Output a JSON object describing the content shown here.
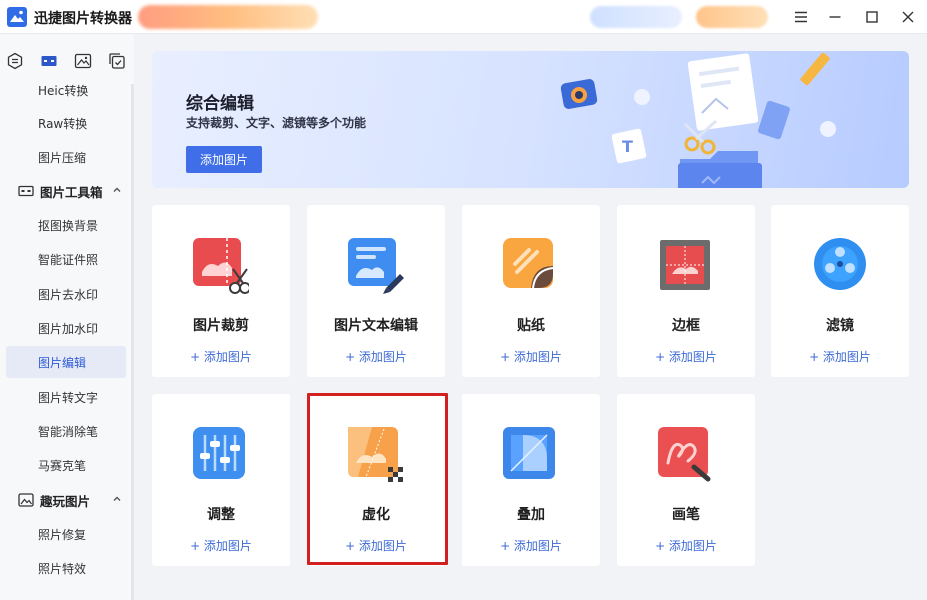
{
  "app": {
    "title": "迅捷图片转换器"
  },
  "sidebar": {
    "items": [
      {
        "label": "Heic转换",
        "active": false
      },
      {
        "label": "Raw转换",
        "active": false
      },
      {
        "label": "图片压缩",
        "active": false
      }
    ],
    "group_toolbox": "图片工具箱",
    "toolbox_items": [
      {
        "label": "抠图换背景"
      },
      {
        "label": "智能证件照"
      },
      {
        "label": "图片去水印"
      },
      {
        "label": "图片加水印"
      },
      {
        "label": "图片编辑"
      },
      {
        "label": "图片转文字"
      },
      {
        "label": "智能消除笔"
      },
      {
        "label": "马赛克笔"
      }
    ],
    "group_fun": "趣玩图片",
    "fun_items": [
      {
        "label": "照片修复"
      },
      {
        "label": "照片特效"
      }
    ]
  },
  "hero": {
    "title": "综合编辑",
    "subtitle": "支持裁剪、文字、滤镜等多个功能",
    "button": "添加图片"
  },
  "cards": [
    {
      "label": "图片裁剪",
      "add": "+ 添加图片",
      "icon": "crop-icon"
    },
    {
      "label": "图片文本编辑",
      "add": "+ 添加图片",
      "icon": "text-edit-icon"
    },
    {
      "label": "贴纸",
      "add": "+ 添加图片",
      "icon": "sticker-icon"
    },
    {
      "label": "边框",
      "add": "+ 添加图片",
      "icon": "border-icon"
    },
    {
      "label": "滤镜",
      "add": "+ 添加图片",
      "icon": "filter-icon"
    },
    {
      "label": "调整",
      "add": "+ 添加图片",
      "icon": "adjust-icon"
    },
    {
      "label": "虚化",
      "add": "+ 添加图片",
      "icon": "blur-icon"
    },
    {
      "label": "叠加",
      "add": "+ 添加图片",
      "icon": "overlay-icon"
    },
    {
      "label": "画笔",
      "add": "+ 添加图片",
      "icon": "brush-icon"
    }
  ],
  "colors": {
    "accent": "#3f6ee8",
    "link": "#3d6ad6",
    "highlight": "#d21f1f"
  }
}
